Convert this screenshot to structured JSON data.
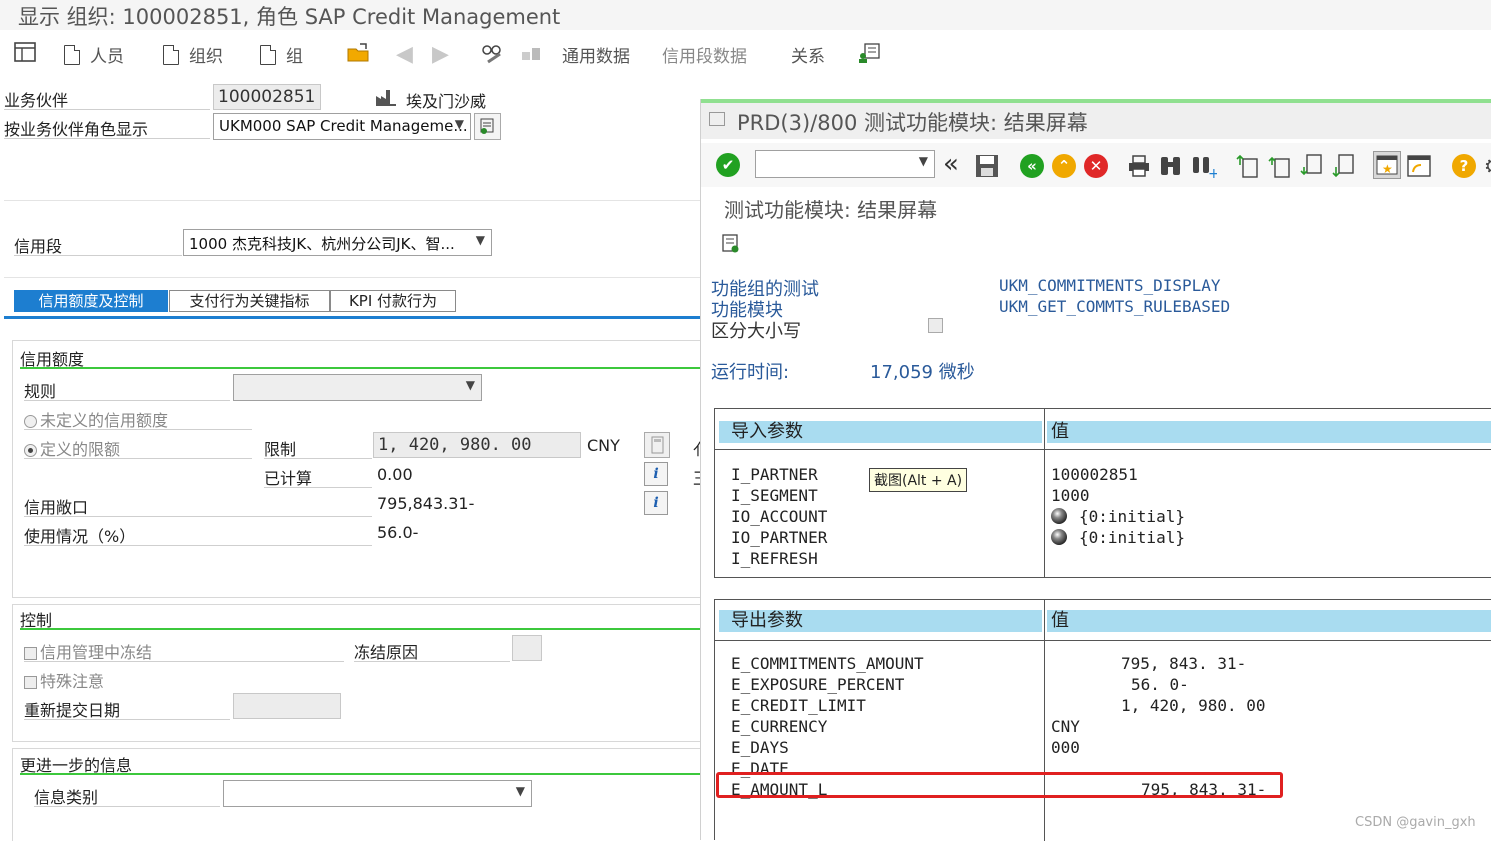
{
  "window": {
    "title": "显示 组织: 100002851, 角色 SAP Credit Management"
  },
  "toolbar": {
    "items": [
      "人员",
      "组织",
      "组"
    ],
    "general_data": "通用数据",
    "credit_segment_data": "信用段数据",
    "relations": "关系"
  },
  "header": {
    "bp_label": "业务伙伴",
    "bp_value": "100002851",
    "bp_name": "埃及门沙威",
    "role_label": "按业务伙伴角色显示",
    "role_value": "UKM000 SAP Credit Manageme..."
  },
  "segment": {
    "label": "信用段",
    "value": "1000 杰克科技JK、杭州分公司JK、智..."
  },
  "tabs": [
    "信用额度及控制",
    "支付行为关键指标",
    "KPI 付款行为"
  ],
  "credit": {
    "section": "信用额度",
    "rule_label": "规则",
    "undefined_label": "未定义的信用额度",
    "defined_label": "定义的限额",
    "limit_label": "限制",
    "limit_value": "1, 420, 980. 00",
    "currency": "CNY",
    "calc_label": "已计算",
    "calc_value": "0.00",
    "exposure_label": "信用敞口",
    "exposure_value": "795,843.31-",
    "usage_label": "使用情况（%）",
    "usage_value": "56.0-",
    "cut_a": "亻",
    "cut_b": "王"
  },
  "control": {
    "section": "控制",
    "blocked_label": "信用管理中冻结",
    "block_reason_label": "冻结原因",
    "special_label": "特殊注意",
    "resubmit_label": "重新提交日期"
  },
  "further": {
    "section": "更进一步的信息",
    "info_type_label": "信息类别"
  },
  "dialog": {
    "title": "PRD(3)/800 测试功能模块: 结果屏幕",
    "subtitle": "测试功能模块: 结果屏幕",
    "fg_label": "功能组的测试",
    "fg_value": "UKM_COMMITMENTS_DISPLAY",
    "fm_label": "功能模块",
    "fm_value": "UKM_GET_COMMTS_RULEBASED",
    "case_label": "区分大小写",
    "runtime_label": "运行时间:",
    "runtime_value": "17,059 微秒",
    "import_header": "导入参数",
    "value_header": "值",
    "export_header": "导出参数",
    "tooltip": "截图(Alt + A)",
    "import_params": [
      "I_PARTNER",
      "I_SEGMENT",
      "IO_ACCOUNT",
      "IO_PARTNER",
      "I_REFRESH"
    ],
    "import_values": [
      "100002851",
      "1000",
      "{0:initial}",
      "{0:initial}"
    ],
    "export_params": [
      "E_COMMITMENTS_AMOUNT",
      "E_EXPOSURE_PERCENT",
      "E_CREDIT_LIMIT",
      "E_CURRENCY",
      "E_DAYS",
      "E_DATE",
      "E_AMOUNT_L"
    ],
    "export_values": [
      "795, 843. 31-",
      "56. 0-",
      "1, 420, 980. 00",
      "CNY",
      "000",
      "",
      "795, 843. 31-"
    ]
  },
  "watermark": "CSDN @gavin_gxh",
  "colors": {
    "accent": "#1d7ed0",
    "highlight": "#e02020",
    "section_line": "#3cc83c",
    "param_header": "#a9dcf0"
  }
}
